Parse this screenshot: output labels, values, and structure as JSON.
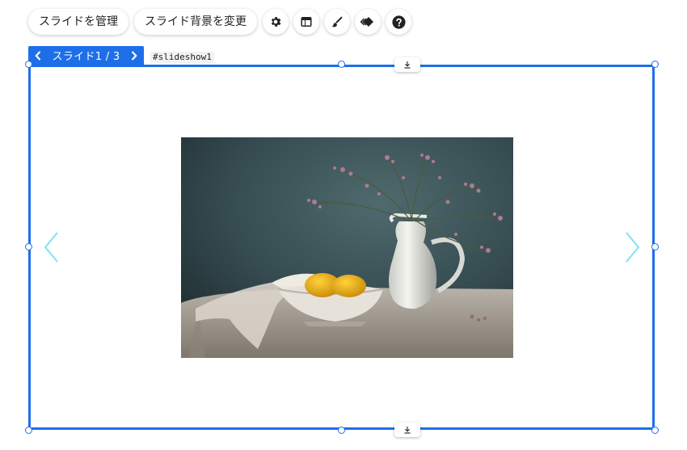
{
  "toolbar": {
    "manage_slides_label": "スライドを管理",
    "change_background_label": "スライド背景を変更",
    "icons": [
      "gear-icon",
      "layout-icon",
      "brush-icon",
      "animation-icon",
      "help-icon"
    ]
  },
  "slide_nav": {
    "counter": "スライド1 / 3"
  },
  "element_id": "#slideshow1",
  "colors": {
    "accent": "#1e6ee8",
    "slide_arrow": "#7fe3ef"
  },
  "slide": {
    "image": "still-life-photo"
  }
}
